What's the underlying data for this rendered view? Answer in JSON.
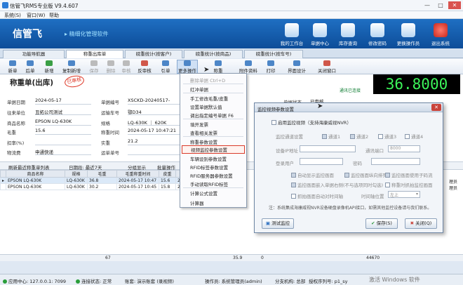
{
  "window": {
    "title": "信管飞RMS专业版 V9.4.607",
    "min": "—",
    "max": "□",
    "close": "✕"
  },
  "menubar": [
    "系统(S)",
    "窗口(W)",
    "帮助"
  ],
  "banner": {
    "brand": "信管飞",
    "slogan": "▸ 精细化管理软件",
    "items": [
      "我的工作台",
      "单据中心",
      "库存查询",
      "修改密码",
      "更换操作员",
      "退出系统"
    ]
  },
  "tabs": [
    "功能导航器",
    "称重出库单",
    "磅重统计(按客户)",
    "磅重统计(按商品)",
    "磅重统计(按车号)"
  ],
  "toolbar": [
    "新单",
    "后单",
    "新增",
    "复制新增",
    "保存",
    "删除",
    "审核",
    "反审核",
    "引单",
    "更多操作",
    "称重",
    "附件资料",
    "打印",
    "界面设计",
    "关闭窗口"
  ],
  "form": {
    "doc_title": "称重单(出库)",
    "stamp": "已审核",
    "bignum": "36.8000",
    "conn_status": "通讯已连接",
    "fields": {
      "date_label": "单据日期",
      "date": "2024-05-17",
      "unit_label": "往来单位",
      "unit": "丑拓公司测试",
      "product_label": "商品名称",
      "product": "EPSON LQ-630K",
      "gross_label": "毛重",
      "gross": "15.6",
      "deduct_label": "扣率(%)",
      "deduct": "",
      "logistics_label": "物流费",
      "logistics": "申通快递",
      "doc_no_label": "单据编号",
      "doc_no": "XSCKD-20240517-0007",
      "vehicle_label": "运输车号",
      "vehicle": "鄂D34",
      "spec_label": "规格",
      "spec": "LQ-630K ｜ 620K",
      "weigh_time_label": "称重时间",
      "weigh_time": "2024-05-17 10:47:21",
      "actual_label": "实重",
      "actual": "21.2",
      "shipper_label": "运单单号",
      "shipper": "",
      "status_label": "单据状态",
      "status": "已审核"
    }
  },
  "gridbar": {
    "refresh": "刷新最近称重单列表",
    "date_label": "日期段: 最近7天",
    "paging": "分组显示",
    "batch": "批量操作"
  },
  "table": {
    "headers": [
      "商品名称",
      "规格",
      "毛重",
      "毛重称重时间",
      "皮重",
      "皮重"
    ],
    "rows": [
      [
        "EPSON LQ-630K",
        "LQ-630K",
        "36.8",
        "2024-05-17 10:47",
        "15.6",
        "2024"
      ],
      [
        "EPSON LQ-630K",
        "LQ-630K",
        "30.2",
        "2024-05-17 10:45",
        "15.8",
        "2024"
      ]
    ],
    "right_col": [
      "理员",
      "理员"
    ]
  },
  "sumrow": {
    "a": "67",
    "b": "35.9",
    "c": "0",
    "d": "44670"
  },
  "statusbar": {
    "server": "应用中心: 127.0.0.1: 7099",
    "conn": "连接状态: 正常",
    "account": "账套: 演示账套 (录视频)",
    "operator": "操作员: 系统管理员(admin)",
    "branch": "分支机构: 总部",
    "auth": "授权序列号: p1_sy",
    "watermark": "激活 Windows 软件"
  },
  "menu": {
    "items": [
      {
        "label": "删除单据   Ctrl+D",
        "disabled": true
      },
      {
        "label": "红冲单据",
        "disabled": false
      },
      {
        "label": "手工修改毛重/皮重",
        "disabled": false
      },
      {
        "label": "设置单据默认值",
        "disabled": false
      },
      {
        "label": "调出指定编号单据  F6",
        "disabled": false
      },
      {
        "label": "填开发票",
        "disabled": false
      },
      {
        "label": "查看相关发票",
        "disabled": false
      },
      {
        "label": "称重参数设置",
        "disabled": false
      },
      {
        "label": "视频监控参数设置",
        "disabled": false
      },
      {
        "label": "车辆设别参数设置",
        "disabled": false
      },
      {
        "label": "RFID标签参数设置",
        "disabled": false
      },
      {
        "label": "RFID服务器参数设置",
        "disabled": false
      },
      {
        "label": "手动读取RFID标签",
        "disabled": false
      },
      {
        "label": "计算公式设置",
        "disabled": false
      },
      {
        "label": "计算器",
        "disabled": false
      }
    ]
  },
  "dialog": {
    "title": "监控视频参数设置",
    "enable_label": "启用监控视频（支持海康威视NVR）",
    "channel_label": "监控通道设置",
    "channels": [
      "通道1",
      "通道2",
      "通道3",
      "通道4"
    ],
    "ip_label": "设备IP地址",
    "port_label": "通讯端口",
    "port_value": "8000",
    "user_label": "登录用户",
    "pwd_label": "密码",
    "opt1": "自动显示监控画面",
    "opt2": "监控画面纵向排列",
    "opt3": "监控画面使用子码流",
    "opt4": "监控画面嵌入单据右侧(不与选项同时勾选)",
    "opt5": "称重时抓拍监控画面",
    "opt6": "抓拍画面自动对时间轴",
    "time_pos_label": "时间轴位置",
    "time_pos_value": "左上",
    "note": "注：系统集成海康威视NVR设备硬盘录像机API接口，如需其他监控设备请与我们联系。",
    "test_btn": "测试监控",
    "save_btn": "保存(S)",
    "close_btn": "关闭(Q)",
    "close_x": "✕"
  },
  "colors": {
    "banner": "#1f6fc3",
    "led": "#3cf55a",
    "highlight": "#d93a2a"
  }
}
